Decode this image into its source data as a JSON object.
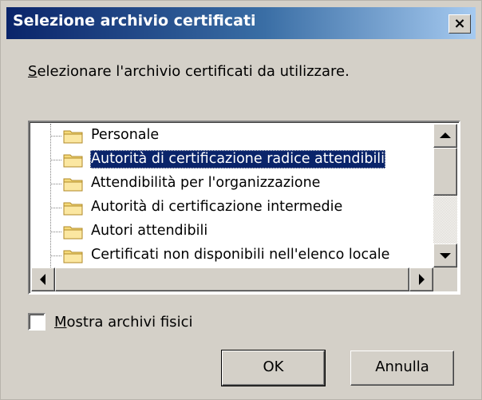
{
  "window": {
    "title": "Selezione archivio certificati",
    "close_glyph": "×"
  },
  "prompt": {
    "mnemonic": "S",
    "rest": "elezionare l'archivio certificati da utilizzare."
  },
  "tree": {
    "items": [
      {
        "label": "Personale",
        "icon": "folder-icon",
        "selected": false
      },
      {
        "label": "Autorità di certificazione radice attendibili",
        "icon": "folder-icon",
        "selected": true
      },
      {
        "label": "Attendibilità per l'organizzazione",
        "icon": "folder-icon",
        "selected": false
      },
      {
        "label": "Autorità di certificazione intermedie",
        "icon": "folder-icon",
        "selected": false
      },
      {
        "label": "Autori attendibili",
        "icon": "folder-icon",
        "selected": false
      },
      {
        "label": "Certificati non disponibili nell'elenco locale",
        "icon": "folder-icon",
        "selected": false
      }
    ]
  },
  "checkbox": {
    "checked": false,
    "mnemonic": "M",
    "rest": "ostra archivi fisici"
  },
  "buttons": {
    "ok_label": "OK",
    "cancel_label": "Annulla"
  },
  "colors": {
    "title_gradient_start": "#0a246a",
    "title_gradient_end": "#a6caf0",
    "selection_bg": "#0a246a",
    "dialog_bg": "#d4d0c8",
    "folder_yellow": "#f5d97a"
  }
}
